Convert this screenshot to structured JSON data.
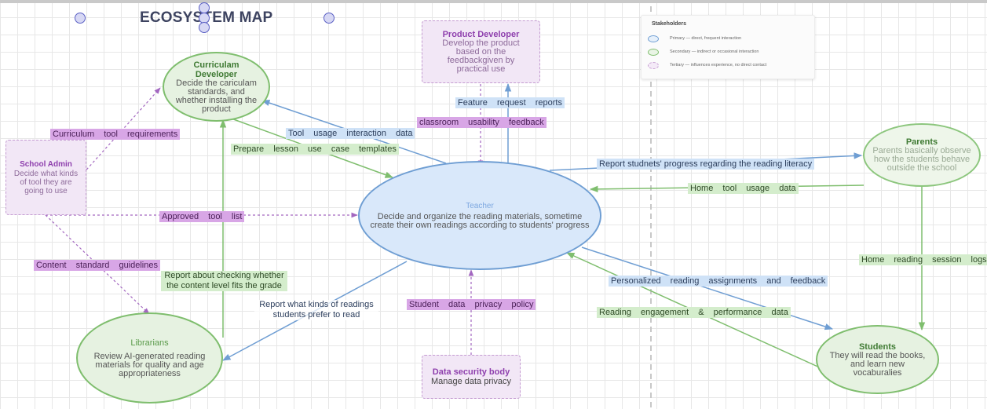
{
  "map": {
    "title": "ECOSYSTEM MAP"
  },
  "legend": {
    "title": "Stakeholders",
    "items": [
      {
        "text": "Primary — direct, frequent interaction",
        "style": "primary"
      },
      {
        "text": "Secondary — indirect or occasional interaction",
        "style": "secondary"
      },
      {
        "text": "Tertiary — influences experience, no direct contact",
        "style": "tertiary"
      }
    ]
  },
  "colors": {
    "primary": "#6f9ed3",
    "secondary": "#7fbe6e",
    "tertiary": "#c49bd1",
    "title_text": "#3d4360"
  },
  "nodes": {
    "teacher": {
      "title": "Teacher",
      "desc": "Decide and organize the reading materials, sometime create their own readings according to students' progress"
    },
    "curriculum": {
      "title": "Curriculam Developer",
      "desc": "Decide the  cariculam standards, and whether installing the product"
    },
    "product": {
      "title": "Product Developer",
      "desc": "Develop the product based on the feedbackgiven by practical use"
    },
    "parents": {
      "title": "Parents",
      "desc": "Parents basically observe how the students behave outside the school"
    },
    "admin": {
      "title": "School Admin",
      "desc": "Decide what kinds of tool they are going to use"
    },
    "librarians": {
      "title": "Librarians",
      "desc": "Review AI-generated reading materials for quality and age appropriateness"
    },
    "datasec": {
      "title": "Data security body",
      "desc": "Manage data privacy"
    },
    "students": {
      "title": "Students",
      "desc": "They will read the books, and learn new vocaburalies"
    }
  },
  "edge_labels": {
    "curriculum_reqs": "Curriculum tool requirements",
    "tool_usage": "Tool usage interaction data",
    "classroom_feedback": "classroom usability feedback",
    "feature_request": "Feature request reports",
    "lesson_templates": "Prepare lesson use case templates",
    "report_progress": "Report studnets' progress regarding the reading literacy",
    "home_tool_usage": "Home tool usage data",
    "approved_tools": "Approved tool list",
    "content_standards": "Content standard guidelines",
    "content_level": "Report about checking whether the content level fits the grade",
    "reading_prefs": "Report what kinds of readings students prefer to read",
    "privacy_policy": "Student data privacy policy",
    "personalized": "Personalized reading assignments and feedback",
    "engagement": "Reading engagement & performance data",
    "home_logs": "Home reading session logs"
  }
}
